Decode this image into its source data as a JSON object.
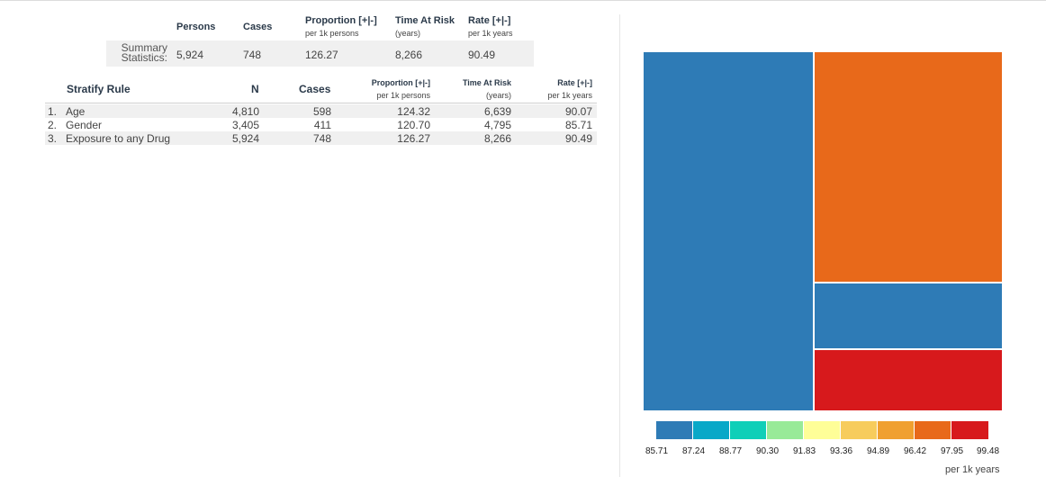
{
  "summary": {
    "headers": {
      "persons": "Persons",
      "cases": "Cases",
      "proportion": "Proportion [+|-]",
      "proportion_sub": "per 1k persons",
      "time_at_risk": "Time At Risk",
      "time_at_risk_sub": "(years)",
      "rate": "Rate [+|-]",
      "rate_sub": "per 1k years"
    },
    "label_line1": "Summary",
    "label_line2": "Statistics:",
    "persons": "5,924",
    "cases": "748",
    "proportion": "126.27",
    "time_at_risk": "8,266",
    "rate": "90.49"
  },
  "stratify": {
    "headers": {
      "rule": "Stratify Rule",
      "n": "N",
      "cases": "Cases",
      "proportion": "Proportion [+|-]",
      "proportion_sub": "per 1k persons",
      "time_at_risk": "Time At Risk",
      "time_at_risk_sub": "(years)",
      "rate": "Rate [+|-]",
      "rate_sub": "per 1k years"
    },
    "rows": [
      {
        "index": "1.",
        "rule": "Age",
        "n": "4,810",
        "cases": "598",
        "proportion": "124.32",
        "tar": "6,639",
        "rate": "90.07"
      },
      {
        "index": "2.",
        "rule": "Gender",
        "n": "3,405",
        "cases": "411",
        "proportion": "120.70",
        "tar": "4,795",
        "rate": "85.71"
      },
      {
        "index": "3.",
        "rule": "Exposure to any Drug",
        "n": "5,924",
        "cases": "748",
        "proportion": "126.27",
        "tar": "8,266",
        "rate": "90.49"
      }
    ]
  },
  "treemap": {
    "tiles": [
      {
        "color": "#2e7bb6"
      },
      {
        "color": "#e8691a"
      },
      {
        "color": "#2e7bb6"
      },
      {
        "color": "#d7191c"
      }
    ]
  },
  "legend": {
    "colors": [
      "#2e7bb6",
      "#08a8c8",
      "#0fcfb8",
      "#98ea98",
      "#fefe98",
      "#f7cc5d",
      "#f0a030",
      "#e8691a",
      "#d7191c"
    ],
    "ticks": [
      "85.71",
      "87.24",
      "88.77",
      "90.30",
      "91.83",
      "93.36",
      "94.89",
      "96.42",
      "97.95",
      "99.48"
    ],
    "unit": "per 1k years"
  }
}
